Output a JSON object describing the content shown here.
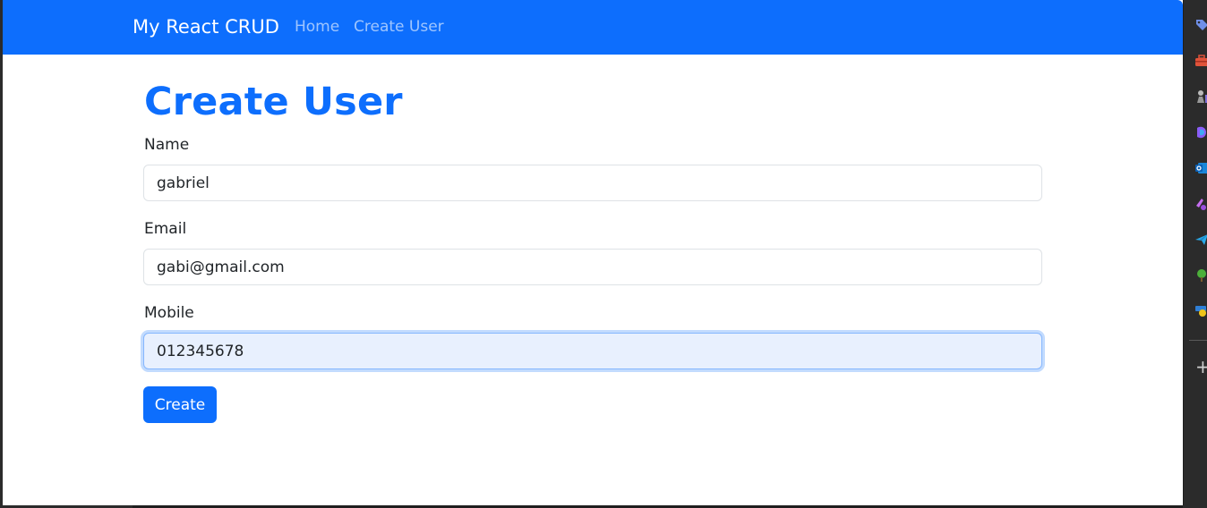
{
  "navbar": {
    "brand": "My React CRUD",
    "links": [
      {
        "label": "Home"
      },
      {
        "label": "Create User"
      }
    ]
  },
  "page": {
    "title": "Create User"
  },
  "form": {
    "name": {
      "label": "Name",
      "value": "gabriel"
    },
    "email": {
      "label": "Email",
      "value": "gabi@gmail.com"
    },
    "mobile": {
      "label": "Mobile",
      "value": "012345678"
    },
    "submit_label": "Create"
  },
  "sidebar_panel": {
    "icons": [
      "tag-icon",
      "toolbox-icon",
      "chess-icon",
      "copilot-icon",
      "outlook-icon",
      "games-icon",
      "send-icon",
      "tree-icon",
      "drop-icon"
    ],
    "add_label": "+"
  },
  "colors": {
    "primary": "#0d6efd",
    "heading": "#0d6efd",
    "text": "#212529",
    "input_focus_bg": "#e8f0fe"
  }
}
